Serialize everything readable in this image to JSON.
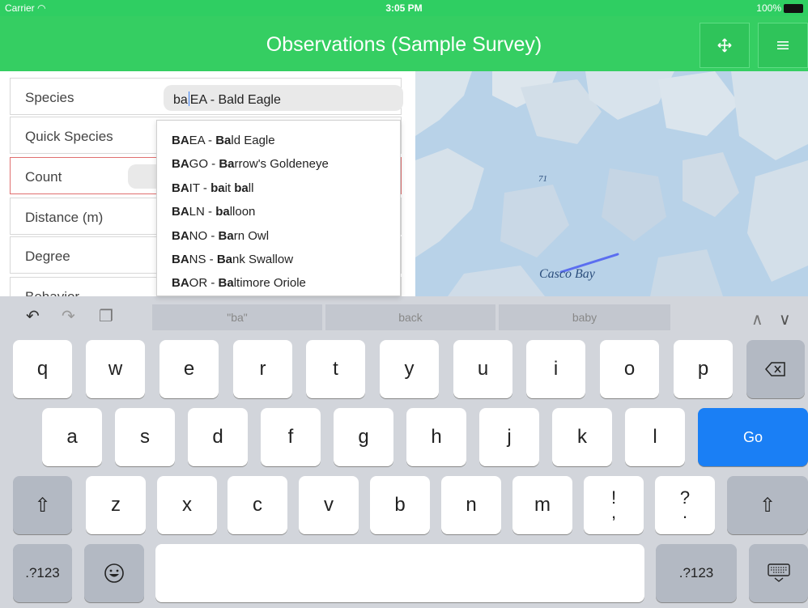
{
  "status_bar": {
    "carrier": "Carrier",
    "time": "3:05 PM",
    "battery": "100%"
  },
  "nav": {
    "title": "Observations (Sample Survey)",
    "move_icon": "move-icon",
    "menu_icon": "menu-icon"
  },
  "form": {
    "species_label": "Species",
    "species_typed": "ba",
    "species_completion": "EA - Bald Eagle",
    "quick_species_label": "Quick Species",
    "count_label": "Count",
    "distance_label": "Distance (m)",
    "degree_label": "Degree",
    "behavior_label": "Behavior"
  },
  "suggestions": [
    {
      "b1": "BA",
      "t1": "EA - ",
      "b2": "Ba",
      "t2": "ld Eagle"
    },
    {
      "b1": "BA",
      "t1": "GO - ",
      "b2": "Ba",
      "t2": "rrow's Goldeneye"
    },
    {
      "b1": "BA",
      "t1": "IT - ",
      "b2": "ba",
      "t2": "it ",
      "b3": "ba",
      "t3": "ll"
    },
    {
      "b1": "BA",
      "t1": "LN - ",
      "b2": "ba",
      "t2": "lloon"
    },
    {
      "b1": "BA",
      "t1": "NO - ",
      "b2": "Ba",
      "t2": "rn Owl"
    },
    {
      "b1": "BA",
      "t1": "NS - ",
      "b2": "Ba",
      "t2": "nk Swallow"
    },
    {
      "b1": "BA",
      "t1": "OR - ",
      "b2": "Ba",
      "t2": "ltimore Oriole"
    }
  ],
  "map": {
    "place_label": "Casco Bay",
    "depth_label": "71",
    "track_color": "#5b6ef0"
  },
  "keyboard": {
    "predictions": [
      "\"ba\"",
      "back",
      "baby"
    ],
    "row1": [
      "q",
      "w",
      "e",
      "r",
      "t",
      "y",
      "u",
      "i",
      "o",
      "p"
    ],
    "row2": [
      "a",
      "s",
      "d",
      "f",
      "g",
      "h",
      "j",
      "k",
      "l"
    ],
    "row3": [
      "z",
      "x",
      "c",
      "v",
      "b",
      "n",
      "m"
    ],
    "punct1": [
      "!",
      ","
    ],
    "punct2": [
      "?",
      "."
    ],
    "go_label": "Go",
    "numbers_label": ".?123",
    "accent_color": "#1a7ff5"
  }
}
